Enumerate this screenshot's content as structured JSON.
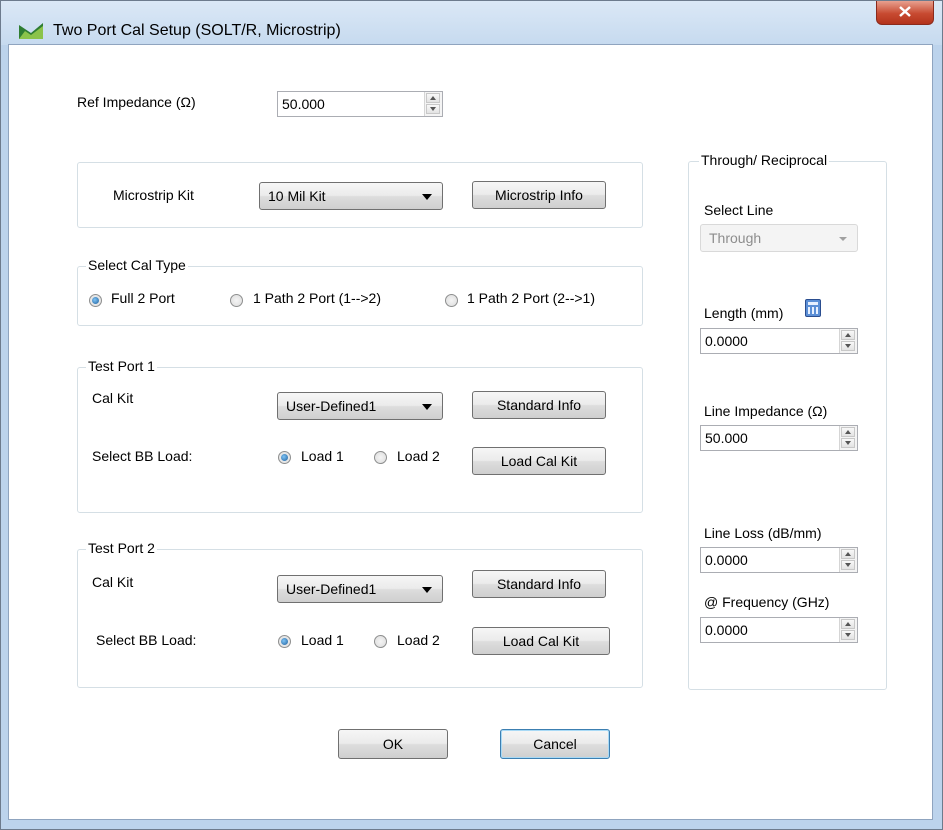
{
  "window": {
    "title": "Two Port Cal Setup (SOLT/R, Microstrip)"
  },
  "ref_impedance": {
    "label": "Ref Impedance (Ω)",
    "value": "50.000"
  },
  "microstrip": {
    "label": "Microstrip Kit",
    "selected": "10 Mil Kit",
    "info_button": "Microstrip Info"
  },
  "cal_type": {
    "title": "Select Cal Type",
    "options": [
      "Full 2 Port",
      "1 Path 2 Port (1-->2)",
      "1 Path 2 Port (2-->1)"
    ],
    "selected_index": 0
  },
  "port1": {
    "title": "Test Port 1",
    "cal_kit_label": "Cal Kit",
    "cal_kit_value": "User-Defined1",
    "standard_info_button": "Standard Info",
    "bb_load_label": "Select BB Load:",
    "load1": "Load 1",
    "load2": "Load 2",
    "load_cal_kit_button": "Load Cal Kit"
  },
  "port2": {
    "title": "Test Port 2",
    "cal_kit_label": "Cal Kit",
    "cal_kit_value": "User-Defined1",
    "standard_info_button": "Standard Info",
    "bb_load_label": "Select BB Load:",
    "load1": "Load 1",
    "load2": "Load 2",
    "load_cal_kit_button": "Load Cal Kit"
  },
  "through": {
    "title": "Through/ Reciprocal",
    "select_line_label": "Select Line",
    "select_line_value": "Through",
    "length_label": "Length (mm)",
    "length_value": "0.0000",
    "line_impedance_label": "Line Impedance (Ω)",
    "line_impedance_value": "50.000",
    "line_loss_label": "Line Loss (dB/mm)",
    "line_loss_value": "0.0000",
    "frequency_label": "@ Frequency (GHz)",
    "frequency_value": "0.0000"
  },
  "buttons": {
    "ok": "OK",
    "cancel": "Cancel"
  },
  "colors": {
    "title_bar": "#c6daef",
    "close_button": "#c74a31",
    "radio_selected": "#1d5f9c"
  }
}
